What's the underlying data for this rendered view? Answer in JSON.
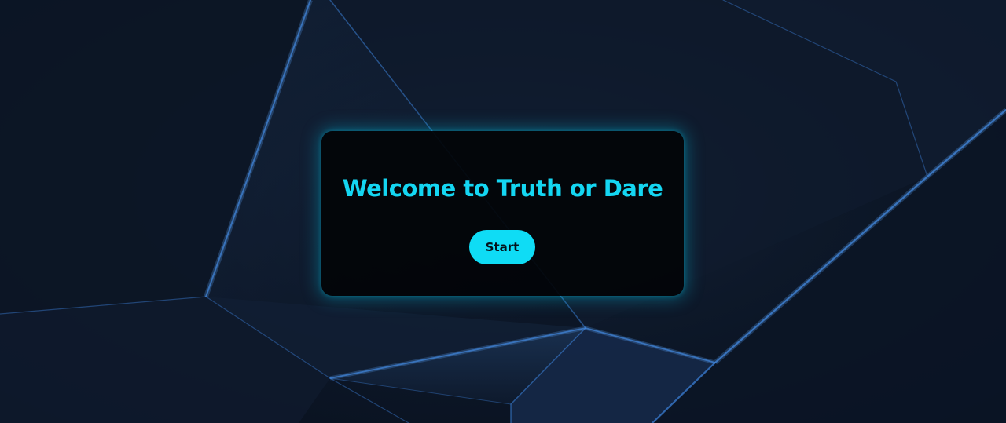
{
  "page": {
    "title": "Welcome to Truth or Dare",
    "start_label": "Start"
  },
  "colors": {
    "accent": "#14d6f2",
    "button_bg": "#0fdcf5",
    "card_bg": "#020408",
    "background": "#0d1829"
  }
}
